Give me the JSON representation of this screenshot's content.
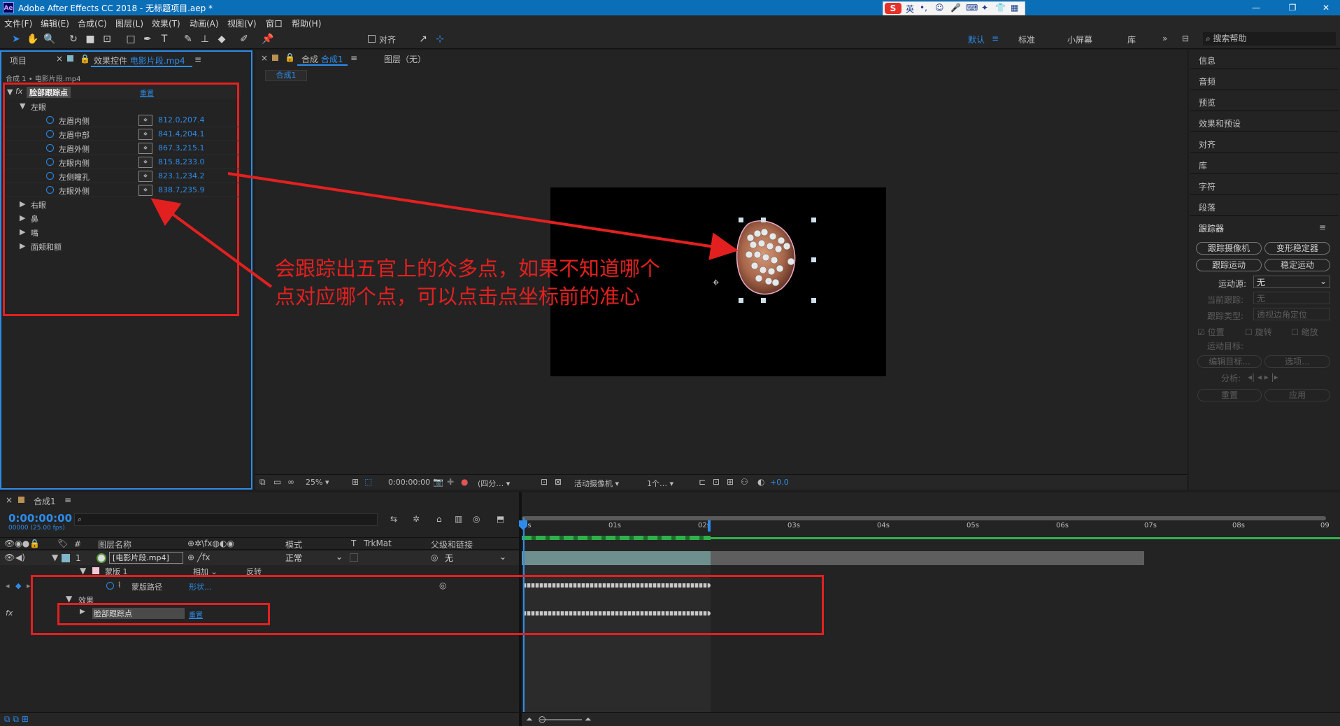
{
  "window": {
    "title": "Adobe After Effects CC 2018 - 无标题项目.aep *",
    "app_icon": "Ae",
    "controls": [
      "minimize-icon",
      "maximize-icon",
      "close-icon"
    ]
  },
  "ime": {
    "lang": "英"
  },
  "menu": [
    "文件(F)",
    "编辑(E)",
    "合成(C)",
    "图层(L)",
    "效果(T)",
    "动画(A)",
    "视图(V)",
    "窗口",
    "帮助(H)"
  ],
  "toolbar": {
    "align_label": "对齐",
    "workspaces": [
      "默认",
      "标准",
      "小屏幕",
      "库"
    ],
    "active_workspace": "默认",
    "search_help": "搜索帮助"
  },
  "left_panel": {
    "tab_project": "项目",
    "tab_effects_prefix": "效果控件",
    "tab_effects_file": "电影片段.mp4",
    "breadcrumb": "合成 1 • 电影片段.mp4",
    "effect_name": "脸部跟踪点",
    "reset": "重置",
    "group_left_eye": "左眼",
    "props": [
      {
        "label": "左眉内侧",
        "value": "812.0,207.4"
      },
      {
        "label": "左眉中部",
        "value": "841.4,204.1"
      },
      {
        "label": "左眉外侧",
        "value": "867.3,215.1"
      },
      {
        "label": "左眼内侧",
        "value": "815.8,233.0"
      },
      {
        "label": "左侧瞳孔",
        "value": "823.1,234.2"
      },
      {
        "label": "左眼外侧",
        "value": "838.7,235.9"
      }
    ],
    "groups": [
      "右眼",
      "鼻",
      "嘴",
      "面颊和额"
    ]
  },
  "comp_panel": {
    "tab_label": "合成",
    "tab_name": "合成1",
    "layer_tab": "图层（无）",
    "sub_tab": "合成1",
    "annotation_line1": "会跟踪出五官上的众多点，如果不知道哪个",
    "annotation_line2": "点对应哪个点，可以点击点坐标前的准心",
    "footer": {
      "zoom": "25%",
      "timecode": "0:00:00:00",
      "resolution": "(四分…",
      "camera": "活动摄像机",
      "views": "1个…",
      "exposure": "+0.0"
    }
  },
  "right_panel": {
    "items": [
      "信息",
      "音频",
      "预览",
      "效果和预设",
      "对齐",
      "库",
      "字符",
      "段落"
    ],
    "tracker_title": "跟踪器",
    "tracker_buttons": [
      "跟踪摄像机",
      "变形稳定器",
      "跟踪运动",
      "稳定运动"
    ],
    "motion_source_label": "运动源:",
    "motion_source_value": "无",
    "current_track_label": "当前跟踪:",
    "current_track_value": "无",
    "track_type_label": "跟踪类型:",
    "track_type_value": "透视边角定位",
    "checkbox_position": "位置",
    "checkbox_rotation": "旋转",
    "checkbox_scale": "缩放",
    "motion_target_label": "运动目标:",
    "edit_target": "编辑目标...",
    "options": "选项...",
    "analyze_label": "分析:",
    "reset": "重置",
    "apply": "应用"
  },
  "timeline": {
    "tab": "合成1",
    "timecode": "0:00:00:00",
    "fps": "00000 (25.00 fps)",
    "col_num": "#",
    "col_layer": "图层名称",
    "col_mode": "模式",
    "col_t": "T",
    "col_trkmat": "TrkMat",
    "col_parent": "父级和链接",
    "layer_index": "1",
    "layer_name": "[电影片段.mp4]",
    "layer_mode": "正常",
    "layer_parent": "无",
    "mask_name": "蒙版 1",
    "mask_mode": "相加",
    "mask_invert": "反转",
    "mask_path": "蒙版路径",
    "mask_shape": "形状...",
    "effects": "效果",
    "effect_name": "脸部跟踪点",
    "effect_reset": "重置",
    "ruler": [
      "0s",
      "01s",
      "02s",
      "03s",
      "04s",
      "05s",
      "06s",
      "07s",
      "08s",
      "09"
    ]
  },
  "colors": {
    "accent_blue": "#2d8ceb",
    "annotation_red": "#e32020",
    "panel_bg": "#232323"
  }
}
